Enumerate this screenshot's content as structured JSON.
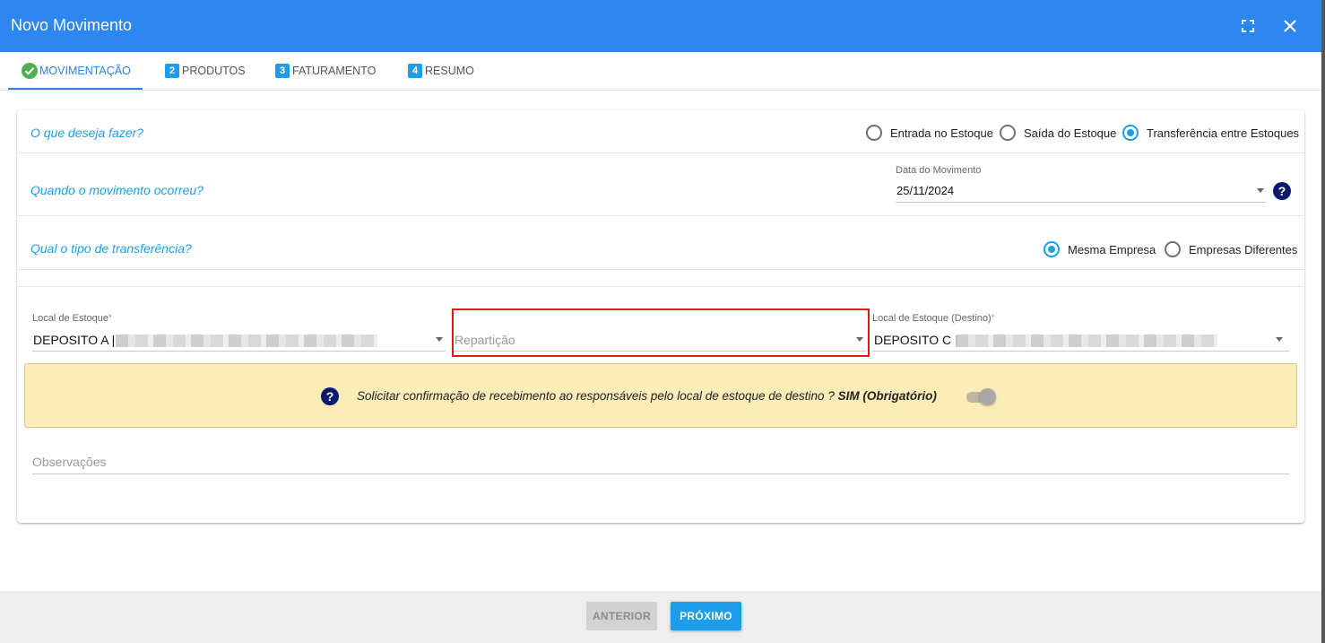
{
  "window": {
    "title": "Novo Movimento",
    "fullscreen_icon": "fullscreen-icon",
    "close_icon": "close-icon"
  },
  "tabs": [
    {
      "step": "",
      "label": "MOVIMENTAÇÃO",
      "state": "completed"
    },
    {
      "step": "2",
      "label": "PRODUTOS",
      "state": "pending"
    },
    {
      "step": "3",
      "label": "FATURAMENTO",
      "state": "pending"
    },
    {
      "step": "4",
      "label": "RESUMO",
      "state": "pending"
    }
  ],
  "form": {
    "operation": {
      "question": "O que deseja fazer?",
      "options": [
        "Entrada no Estoque",
        "Saída do Estoque",
        "Transferência entre Estoques"
      ],
      "selected": "Transferência entre Estoques"
    },
    "date": {
      "question": "Quando o movimento ocorreu?",
      "label": "Data do Movimento",
      "value": "25/11/2024",
      "help": "?"
    },
    "transfer_type": {
      "question": "Qual o tipo de transferência?",
      "options": [
        "Mesma Empresa",
        "Empresas Diferentes"
      ],
      "selected": "Mesma Empresa"
    },
    "stock_location": {
      "label": "Local de Estoque",
      "required": "*",
      "value": "DEPOSITO A |"
    },
    "department": {
      "placeholder": "Repartição"
    },
    "destination_location": {
      "label": "Local de Estoque (Destino)",
      "required": "*",
      "value": "DEPOSITO C |"
    },
    "confirmation": {
      "help": "?",
      "text": "Solicitar confirmação de recebimento ao responsáveis pelo local de estoque de destino ?",
      "status": "SIM (Obrigatório)",
      "enabled": true
    },
    "observations": {
      "placeholder": "Observações"
    }
  },
  "footer": {
    "prev_label": "ANTERIOR",
    "next_label": "PRÓXIMO"
  },
  "colors": {
    "header": "#2e86f0",
    "accent": "#1e9ee8",
    "notice_bg": "#fbecb8",
    "highlight": "#e8141b"
  }
}
